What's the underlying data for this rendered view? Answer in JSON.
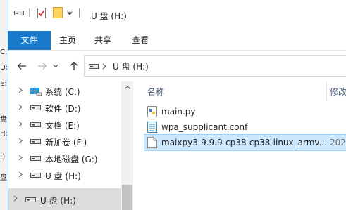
{
  "background_window": {
    "fragments": [
      "C:",
      "D:",
      "E:)",
      "盘",
      "H:",
      ":)",
      "盘"
    ]
  },
  "window": {
    "title": "U 盘 (H:)",
    "quick_access": [
      "drive-icon",
      "properties-icon",
      "new-folder-icon",
      "customize-dropdown-icon"
    ]
  },
  "ribbon": {
    "tabs": [
      "文件",
      "主页",
      "共享",
      "查看"
    ],
    "active_tab": "文件",
    "accent": "#1979ca"
  },
  "address": {
    "path": "U 盘 (H:)"
  },
  "nav": {
    "items": [
      {
        "label": "系统 (C:)",
        "icon": "windows-drive-icon"
      },
      {
        "label": "软件 (D:)",
        "icon": "drive-icon"
      },
      {
        "label": "文档 (E:)",
        "icon": "drive-icon"
      },
      {
        "label": "新加卷 (F:)",
        "icon": "drive-icon"
      },
      {
        "label": "本地磁盘 (G:)",
        "icon": "drive-icon"
      },
      {
        "label": "U 盘 (H:)",
        "icon": "drive-icon"
      }
    ],
    "selected": {
      "label": "U 盘 (H:)",
      "icon": "drive-icon"
    }
  },
  "files": {
    "columns": {
      "name": "名称",
      "modified": "修改"
    },
    "rows": [
      {
        "name": "main.py",
        "date": "",
        "icon": "python-file-icon"
      },
      {
        "name": "wpa_supplicant.conf",
        "date": "",
        "icon": "text-file-icon"
      },
      {
        "name": "maixpy3-9.9.9-cp38-cp38-linux_armv...",
        "date": "202",
        "icon": "file-icon",
        "selected": true
      }
    ]
  }
}
